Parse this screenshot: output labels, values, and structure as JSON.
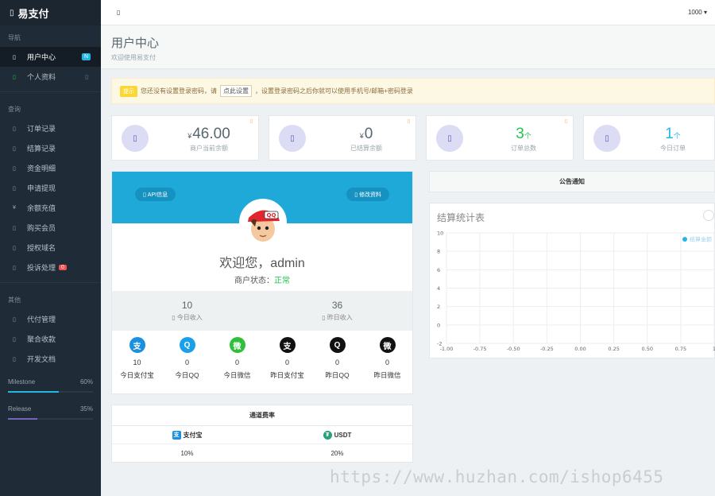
{
  "brand": {
    "icon": "square-icon",
    "name": "易支付"
  },
  "topbar": {
    "toggle_icon": "menu-icon",
    "user": "1000"
  },
  "sidebar": {
    "sections": [
      "导航",
      "查询",
      "其他"
    ],
    "nav": [
      {
        "label": "用户中心",
        "badge": "N",
        "active": true
      },
      {
        "label": "个人资料"
      }
    ],
    "query": [
      {
        "label": "订单记录"
      },
      {
        "label": "结算记录"
      },
      {
        "label": "资金明细"
      },
      {
        "label": "申请提现"
      },
      {
        "label": "余额充值",
        "icon": "¥"
      },
      {
        "label": "购买会员"
      },
      {
        "label": "授权域名"
      },
      {
        "label": "投诉处理",
        "badge": "0"
      }
    ],
    "other": [
      {
        "label": "代付管理"
      },
      {
        "label": "聚合收款"
      },
      {
        "label": "开发文档"
      }
    ],
    "progress": [
      {
        "label": "Milestone",
        "value": "60%",
        "fraction": 0.6,
        "color": "#23b7e5"
      },
      {
        "label": "Release",
        "value": "35%",
        "fraction": 0.35,
        "color": "#7266ba"
      }
    ]
  },
  "header": {
    "title": "用户中心",
    "subtitle": "欢迎使用易支付"
  },
  "alert": {
    "tag": "提示",
    "text_before": "您还没有设置登录密码，请",
    "button": "点此设置",
    "text_after": "，设置登录密码之后你就可以使用手机号/邮箱+密码登录"
  },
  "stats": [
    {
      "currency": "¥",
      "value": "46.00",
      "unit": "",
      "label": "商户当前余额"
    },
    {
      "currency": "¥",
      "value": "0",
      "unit": "",
      "label": "已结算余额"
    },
    {
      "currency": "",
      "value": "3",
      "unit": "个",
      "label": "订单总数"
    },
    {
      "currency": "",
      "value": "1",
      "unit": "个",
      "label": "今日订单"
    }
  ],
  "profile": {
    "api_button": "API信息",
    "edit_button": "修改资料",
    "welcome": "欢迎您，admin",
    "status_label": "商户状态：",
    "status_value": "正常",
    "today_income": "10",
    "today_income_label": "今日收入",
    "yesterday_income": "36",
    "yesterday_income_label": "昨日收入",
    "payments": [
      {
        "count": "10",
        "name": "今日支付宝",
        "color": "#1b8fe0",
        "glyph": "支"
      },
      {
        "count": "0",
        "name": "今日QQ",
        "color": "#1aa0e8",
        "glyph": "Q"
      },
      {
        "count": "0",
        "name": "今日微信",
        "color": "#2fbf3a",
        "glyph": "微"
      },
      {
        "count": "0",
        "name": "昨日支付宝",
        "color": "#111111",
        "glyph": "支"
      },
      {
        "count": "0",
        "name": "昨日QQ",
        "color": "#111111",
        "glyph": "Q"
      },
      {
        "count": "0",
        "name": "昨日微信",
        "color": "#111111",
        "glyph": "微"
      }
    ]
  },
  "rates": {
    "title": "通道费率",
    "channels": [
      {
        "name": "支付宝",
        "rate": "10%",
        "color": "#1b8fe0",
        "glyph": "支"
      },
      {
        "name": "USDT",
        "rate": "20%",
        "color": "#26a17b",
        "glyph": "₮"
      }
    ]
  },
  "notice": {
    "title": "公告通知"
  },
  "chart": {
    "title": "结算统计表",
    "legend": "结算金额"
  },
  "chart_data": {
    "type": "line",
    "title": "结算统计表",
    "series": [
      {
        "name": "结算金额",
        "values": []
      }
    ],
    "x_ticks": [
      "-1.00",
      "-0.75",
      "-0.50",
      "-0.25",
      "0.00",
      "0.25",
      "0.50",
      "0.75",
      "1"
    ],
    "y_ticks": [
      "10",
      "8",
      "6",
      "4",
      "2",
      "0",
      "-2"
    ],
    "xlim": [
      -1,
      1
    ],
    "ylim": [
      -2,
      10
    ],
    "grid": true,
    "legend_position": "top-right"
  },
  "watermark": "https://www.huzhan.com/ishop6455",
  "colors": {
    "accent": "#23b7e5",
    "sidebar": "#1f2b36",
    "success": "#27c24c",
    "warning": "#fad733"
  }
}
